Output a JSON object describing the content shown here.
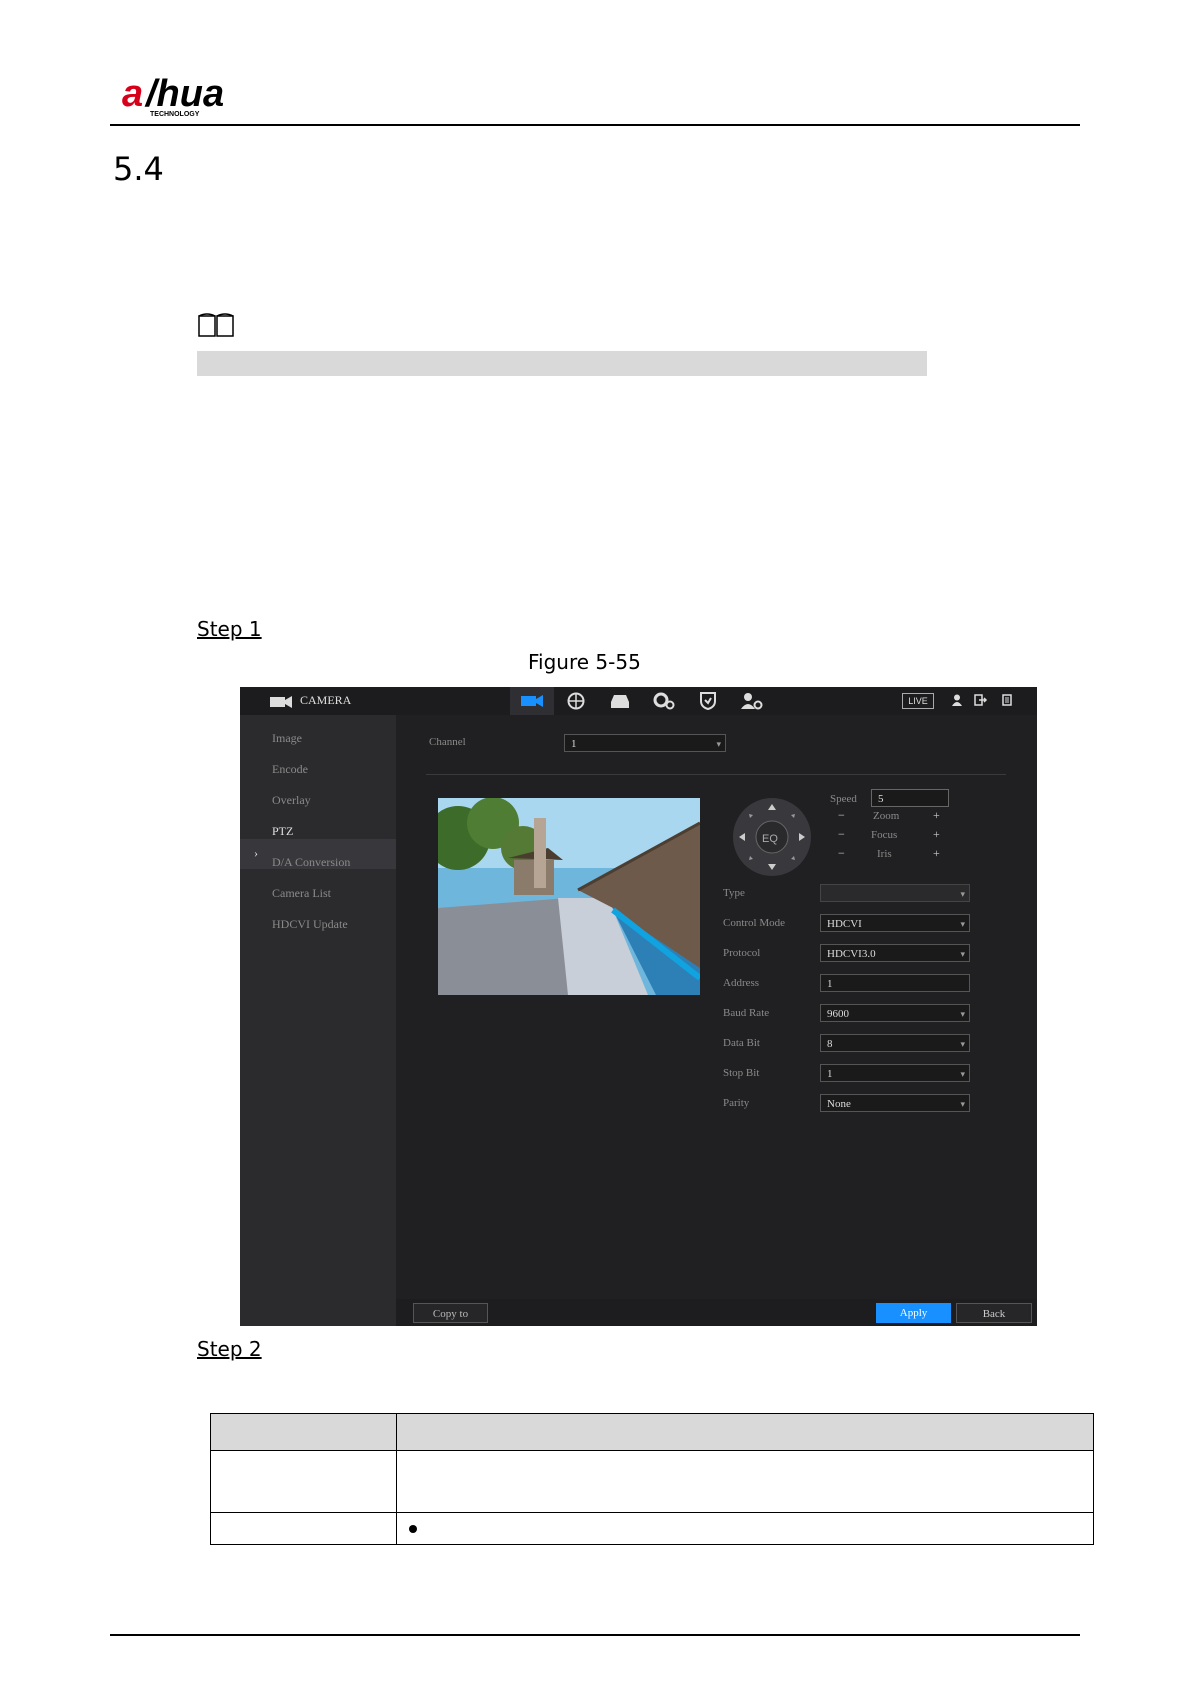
{
  "header": {
    "logo_text": "alhua",
    "logo_subtext": "TECHNOLOGY",
    "brand_color": "#d7001b"
  },
  "section": {
    "number": "5.4"
  },
  "steps": {
    "step1": "Step 1",
    "step2": "Step 2"
  },
  "figure": {
    "caption": "Figure 5-55"
  },
  "ui": {
    "title": "CAMERA",
    "live": "LIVE",
    "main_icons": [
      "camera-icon",
      "network-icon",
      "storage-icon",
      "system-icon",
      "security-icon",
      "account-icon"
    ],
    "sidebar": [
      "Image",
      "Encode",
      "Overlay",
      "PTZ",
      "D/A Conversion",
      "Camera List",
      "HDCVI Update"
    ],
    "channel": {
      "label": "Channel",
      "value": "1"
    },
    "ptz": {
      "speed_label": "Speed",
      "speed_value": "5",
      "zoom": "Zoom",
      "focus": "Focus",
      "iris": "Iris",
      "minus": "−",
      "plus": "+"
    },
    "fields": {
      "type": {
        "label": "Type",
        "value": ""
      },
      "control_mode": {
        "label": "Control Mode",
        "value": "HDCVI"
      },
      "protocol": {
        "label": "Protocol",
        "value": "HDCVI3.0"
      },
      "address": {
        "label": "Address",
        "value": "1"
      },
      "baud_rate": {
        "label": "Baud Rate",
        "value": "9600"
      },
      "data_bit": {
        "label": "Data Bit",
        "value": "8"
      },
      "stop_bit": {
        "label": "Stop Bit",
        "value": "1"
      },
      "parity": {
        "label": "Parity",
        "value": "None"
      }
    },
    "buttons": {
      "copy": "Copy to",
      "apply": "Apply",
      "back": "Back"
    },
    "accent_color": "#1890ff"
  }
}
